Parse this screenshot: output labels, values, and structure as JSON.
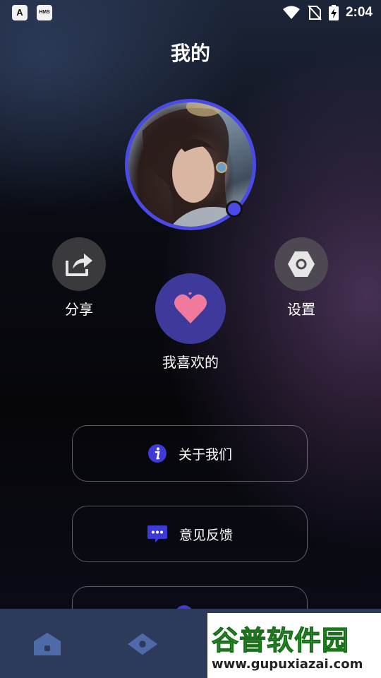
{
  "status_bar": {
    "app_icon_1": "A",
    "app_icon_2": "HMS",
    "time": "2:04",
    "icons": [
      "wifi-icon",
      "no-sim-icon",
      "battery-charging-icon"
    ]
  },
  "header": {
    "title": "我的"
  },
  "profile": {
    "avatar": "avatar-image"
  },
  "actions": {
    "share_label": "分享",
    "settings_label": "设置",
    "favorites_label": "我喜欢的"
  },
  "menu": {
    "items": [
      {
        "label": "关于我们",
        "icon": "info-icon"
      },
      {
        "label": "意见反馈",
        "icon": "feedback-icon"
      },
      {
        "label": "",
        "icon": "circle-icon"
      }
    ]
  },
  "bottom_nav": {
    "items": [
      "home-icon",
      "discover-icon"
    ]
  },
  "watermark": {
    "title": "谷普软件园",
    "url": "www.gupuxiazai.com"
  },
  "colors": {
    "accent": "#4a4ae8",
    "fav_bg": "#3d3a9c",
    "heart": "#f07a9c",
    "nav_bg": "#2e3a5c",
    "watermark_green": "#2aa32a"
  }
}
